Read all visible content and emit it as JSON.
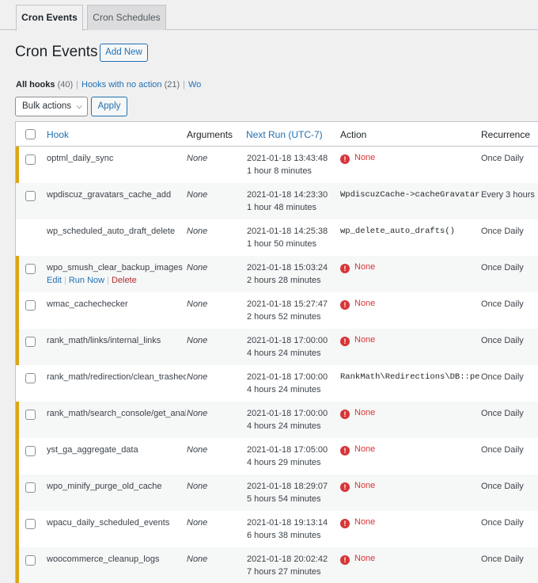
{
  "tabs": [
    {
      "label": "Cron Events",
      "active": true
    },
    {
      "label": "Cron Schedules",
      "active": false
    }
  ],
  "page_title": "Cron Events",
  "add_new_label": "Add New",
  "filters": {
    "all_label": "All hooks",
    "all_count": "(40)",
    "noaction_label": "Hooks with no action",
    "noaction_count": "(21)",
    "wp_label": "Wor"
  },
  "bulk_actions": {
    "selected": "Bulk actions",
    "apply_label": "Apply"
  },
  "columns": {
    "hook": "Hook",
    "arguments": "Arguments",
    "next_run": "Next Run (UTC-7)",
    "action": "Action",
    "recurrence": "Recurrence"
  },
  "row_actions": {
    "edit": "Edit",
    "run_now": "Run Now",
    "delete": "Delete"
  },
  "colors": {
    "accent": "#2271b1",
    "warning_bar": "#dba617",
    "error": "#d63638"
  },
  "rows": [
    {
      "hook": "optml_daily_sync",
      "args": "None",
      "run_date": "2021-01-18 13:43:48",
      "run_rel": "1 hour 8 minutes",
      "action": "None",
      "action_is_none": true,
      "recurrence": "Once Daily",
      "checkbox": true,
      "warning": true
    },
    {
      "hook": "wpdiscuz_gravatars_cache_add",
      "args": "None",
      "run_date": "2021-01-18 14:23:30",
      "run_rel": "1 hour 48 minutes",
      "action": "WpdiscuzCache->cacheGravatars()",
      "action_is_none": false,
      "recurrence": "Every 3 hours",
      "checkbox": true,
      "warning": false
    },
    {
      "hook": "wp_scheduled_auto_draft_delete",
      "args": "None",
      "run_date": "2021-01-18 14:25:38",
      "run_rel": "1 hour 50 minutes",
      "action": "wp_delete_auto_drafts()",
      "action_is_none": false,
      "recurrence": "Once Daily",
      "checkbox": false,
      "warning": false
    },
    {
      "hook": "wpo_smush_clear_backup_images",
      "args": "None",
      "run_date": "2021-01-18 15:03:24",
      "run_rel": "2 hours 28 minutes",
      "action": "None",
      "action_is_none": true,
      "recurrence": "Once Daily",
      "checkbox": true,
      "warning": true,
      "show_actions": true
    },
    {
      "hook": "wmac_cachechecker",
      "args": "None",
      "run_date": "2021-01-18 15:27:47",
      "run_rel": "2 hours 52 minutes",
      "action": "None",
      "action_is_none": true,
      "recurrence": "Once Daily",
      "checkbox": true,
      "warning": true
    },
    {
      "hook": "rank_math/links/internal_links",
      "args": "None",
      "run_date": "2021-01-18 17:00:00",
      "run_rel": "4 hours 24 minutes",
      "action": "None",
      "action_is_none": true,
      "recurrence": "Once Daily",
      "checkbox": true,
      "warning": true
    },
    {
      "hook": "rank_math/redirection/clean_trashed",
      "args": "None",
      "run_date": "2021-01-18 17:00:00",
      "run_rel": "4 hours 24 minutes",
      "action": "RankMath\\Redirections\\DB::periodic_clean_trash()",
      "action_is_none": false,
      "recurrence": "Once Daily",
      "checkbox": true,
      "warning": false
    },
    {
      "hook": "rank_math/search_console/get_analytics",
      "args": "None",
      "run_date": "2021-01-18 17:00:00",
      "run_rel": "4 hours 24 minutes",
      "action": "None",
      "action_is_none": true,
      "recurrence": "Once Daily",
      "checkbox": true,
      "warning": true
    },
    {
      "hook": "yst_ga_aggregate_data",
      "args": "None",
      "run_date": "2021-01-18 17:05:00",
      "run_rel": "4 hours 29 minutes",
      "action": "None",
      "action_is_none": true,
      "recurrence": "Once Daily",
      "checkbox": true,
      "warning": true
    },
    {
      "hook": "wpo_minify_purge_old_cache",
      "args": "None",
      "run_date": "2021-01-18 18:29:07",
      "run_rel": "5 hours 54 minutes",
      "action": "None",
      "action_is_none": true,
      "recurrence": "Once Daily",
      "checkbox": true,
      "warning": true
    },
    {
      "hook": "wpacu_daily_scheduled_events",
      "args": "None",
      "run_date": "2021-01-18 19:13:14",
      "run_rel": "6 hours 38 minutes",
      "action": "None",
      "action_is_none": true,
      "recurrence": "Once Daily",
      "checkbox": true,
      "warning": true
    },
    {
      "hook": "woocommerce_cleanup_logs",
      "args": "None",
      "run_date": "2021-01-18 20:02:42",
      "run_rel": "7 hours 27 minutes",
      "action": "None",
      "action_is_none": true,
      "recurrence": "Once Daily",
      "checkbox": true,
      "warning": true
    }
  ]
}
